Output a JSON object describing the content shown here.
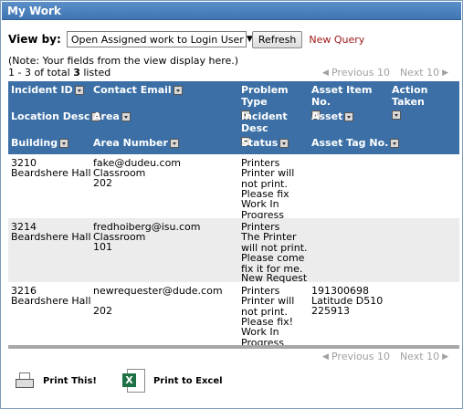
{
  "window": {
    "title": "My Work"
  },
  "viewby": {
    "label": "View by:",
    "selected": "Open Assigned work to Login User",
    "refresh_label": "Refresh",
    "new_query_label": "New Query"
  },
  "note": "(Note: Your fields from the view display here.)",
  "count": {
    "prefix": "1 - 3 of total ",
    "total": "3",
    "suffix": " listed"
  },
  "pager": {
    "prev": "Previous 10",
    "next": "Next 10"
  },
  "columns": {
    "incident_id": "Incident ID",
    "contact_email": "Contact Email",
    "problem_type": "Problem Type",
    "asset_item_no": "Asset Item No.",
    "action_taken": "Action Taken",
    "location_desc": "Location Desc",
    "area": "Area",
    "incident_desc": "Incident Desc",
    "asset": "Asset",
    "building": "Building",
    "area_number": "Area Number",
    "status": "Status",
    "asset_tag_no": "Asset Tag No."
  },
  "rows": [
    {
      "incident_id": "3210",
      "building": "Beardshere Hall",
      "contact_email": "fake@dudeu.com",
      "area": "Classroom",
      "area_number": "202",
      "problem_type": "Printers",
      "incident_desc": "Printer will\nnot print.\nPlease fix",
      "status": "Work In\nProgress",
      "asset_item_no": "",
      "asset": "",
      "asset_tag_no": ""
    },
    {
      "incident_id": "3214",
      "building": "Beardshere Hall",
      "contact_email": "fredhoiberg@isu.com",
      "area": "Classroom",
      "area_number": "101",
      "problem_type": "Printers",
      "incident_desc": "The Printer\nwill not print.\nPlease come\nfix it for me.",
      "status": "New Request",
      "asset_item_no": "",
      "asset": "",
      "asset_tag_no": ""
    },
    {
      "incident_id": "3216",
      "building": "Beardshere Hall",
      "contact_email": "newrequester@dude.com",
      "area": "",
      "area_number": "202",
      "problem_type": "Printers",
      "incident_desc": "Printer will\nnot print.\nPlease fix!",
      "status": "Work In\nProgress",
      "asset_item_no": "191300698",
      "asset": "Latitude D510",
      "asset_tag_no": "225913"
    }
  ],
  "footer": {
    "print_label": "Print This!",
    "excel_label": "Print to Excel"
  },
  "icons": {
    "sort": "sort-dropdown-icon",
    "prev": "arrow-left-icon",
    "next": "arrow-right-icon",
    "print": "printer-icon",
    "excel": "excel-icon"
  }
}
